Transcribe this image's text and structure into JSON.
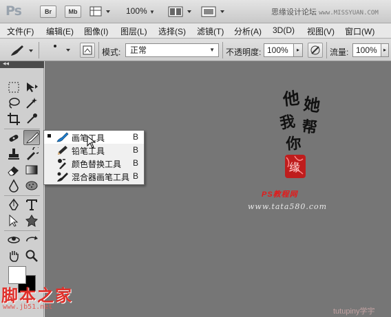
{
  "titlebar": {
    "app_logo": "Ps",
    "bridge_label": "Br",
    "minibridge_label": "Mb",
    "zoom": "100%",
    "watermark_cn": "思缘设计论坛",
    "watermark_url": "www.MISSYUAN.COM"
  },
  "menubar": {
    "items": [
      "文件(F)",
      "编辑(E)",
      "图像(I)",
      "图层(L)",
      "选择(S)",
      "滤镜(T)",
      "分析(A)",
      "3D(D)",
      "视图(V)",
      "窗口(W)"
    ]
  },
  "options": {
    "brush_size": "8",
    "mode_label": "模式:",
    "mode_value": "正常",
    "opacity_label": "不透明度:",
    "opacity_value": "100%",
    "flow_label": "流量:",
    "flow_value": "100%"
  },
  "toolbox": {
    "collapse_glyph": "◂◂"
  },
  "flyout": {
    "items": [
      {
        "label": "画笔工具",
        "key": "B",
        "selected": true,
        "icon": "brush-icon"
      },
      {
        "label": "铅笔工具",
        "key": "B",
        "selected": false,
        "icon": "pencil-icon"
      },
      {
        "label": "颜色替换工具",
        "key": "B",
        "selected": false,
        "icon": "color-replace-icon"
      },
      {
        "label": "混合器画笔工具",
        "key": "B",
        "selected": false,
        "icon": "mixer-brush-icon"
      }
    ]
  },
  "artwork": {
    "calligraphy_chars": [
      "他",
      "她",
      "我",
      "帮",
      "你"
    ],
    "seal_char": "缘",
    "ps_site": "PS教程网",
    "site_url": "www.tata580.com"
  },
  "watermarks": {
    "bottom_logo": "脚本之家",
    "bottom_url": "www.jb51.net",
    "bottom_right": "tutupiny学宇"
  },
  "colors": {
    "canvas": "#767676",
    "foreground": "#ffffff",
    "background": "#000000",
    "accent_red": "#e31a1a"
  }
}
